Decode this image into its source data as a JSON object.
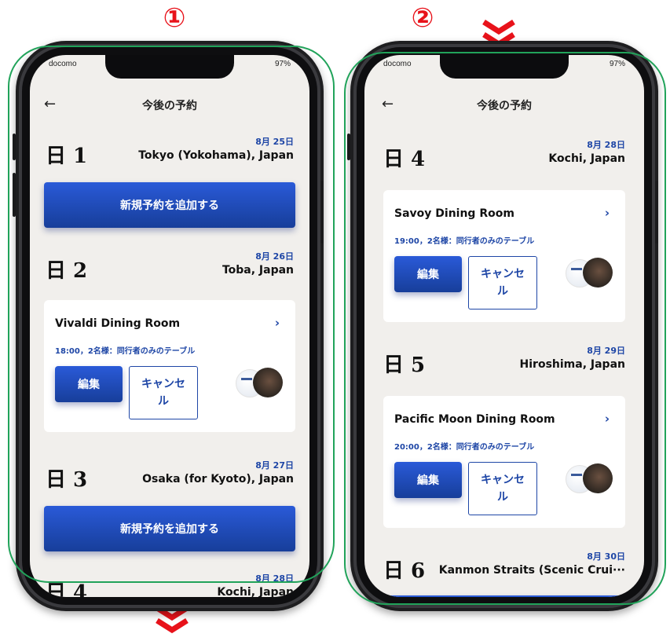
{
  "markers": {
    "left": "①",
    "right": "②"
  },
  "colors": {
    "accent": "#1e46a6",
    "button": "#2150c4",
    "marker": "#e8121a",
    "frame": "#21a35a"
  },
  "icons": {
    "back": "back-arrow-icon",
    "chevron": "chevron-right-icon",
    "scroll": "double-chevron-down-icon"
  },
  "status": {
    "carrier": "docomo",
    "battery": "97%"
  },
  "nav": {
    "back_symbol": "←",
    "title": "今後の予約"
  },
  "phone1": {
    "days": [
      {
        "name": "日 1",
        "date": "8月 25日",
        "place": "Tokyo (Yokohama), Japan",
        "add_label": "新規予約を追加する"
      },
      {
        "name": "日 2",
        "date": "8月 26日",
        "place": "Toba, Japan",
        "booking": {
          "name": "Vivaldi Dining Room",
          "arrow": "›",
          "detail": "18:00，2名様：同行者のみのテーブル",
          "edit": "編集",
          "cancel": "キャンセル"
        }
      },
      {
        "name": "日 3",
        "date": "8月 27日",
        "place": "Osaka (for Kyoto), Japan",
        "add_label": "新規予約を追加する"
      },
      {
        "name": "日 4",
        "date": "8月 28日",
        "place": "Kochi, Japan"
      }
    ]
  },
  "phone2": {
    "days": [
      {
        "name": "日 4",
        "date": "8月 28日",
        "place": "Kochi, Japan",
        "booking": {
          "name": "Savoy Dining Room",
          "arrow": "›",
          "detail": "19:00，2名様：同行者のみのテーブル",
          "edit": "編集",
          "cancel": "キャンセル"
        }
      },
      {
        "name": "日 5",
        "date": "8月 29日",
        "place": "Hiroshima, Japan",
        "booking": {
          "name": "Pacific Moon Dining Room",
          "arrow": "›",
          "detail": "20:00，2名様：同行者のみのテーブル",
          "edit": "編集",
          "cancel": "キャンセル"
        }
      },
      {
        "name": "日 6",
        "date": "8月 30日",
        "place": "Kanmon Straits (Scenic Crui···"
      }
    ]
  }
}
